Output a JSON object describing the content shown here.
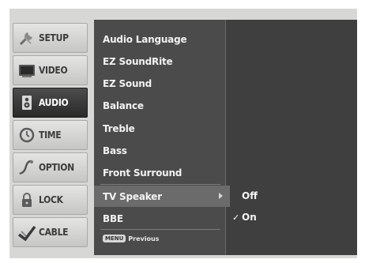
{
  "tabs": [
    {
      "label": "SETUP",
      "icon": "wrench-icon",
      "active": false
    },
    {
      "label": "VIDEO",
      "icon": "tv-icon",
      "active": false
    },
    {
      "label": "AUDIO",
      "icon": "speaker-icon",
      "active": true
    },
    {
      "label": "TIME",
      "icon": "clock-icon",
      "active": false
    },
    {
      "label": "OPTION",
      "icon": "option-icon",
      "active": false
    },
    {
      "label": "LOCK",
      "icon": "lock-icon",
      "active": false
    },
    {
      "label": "CABLE",
      "icon": "cable-icon",
      "active": false
    }
  ],
  "menu": {
    "items": [
      {
        "label": "Audio Language"
      },
      {
        "label": "EZ SoundRite"
      },
      {
        "label": "EZ Sound"
      },
      {
        "label": "Balance"
      },
      {
        "label": "Treble"
      },
      {
        "label": "Bass"
      },
      {
        "label": "Front Surround"
      },
      {
        "label": "TV Speaker"
      },
      {
        "label": "BBE"
      }
    ],
    "selected_item": "TV Speaker",
    "footer": {
      "key": "MENU",
      "label": "Previous"
    }
  },
  "submenu": {
    "options": [
      {
        "label": "Off",
        "checked": false
      },
      {
        "label": "On",
        "checked": true
      }
    ],
    "check_mark": "✓"
  },
  "colors": {
    "panel_bg": "#3f3f3f",
    "list_bg": "#4b4b4b",
    "selected_bg": "#6b6b6b",
    "tab_active_bg": "#2f2f2f",
    "frame_bg": "#d7d8d6"
  }
}
